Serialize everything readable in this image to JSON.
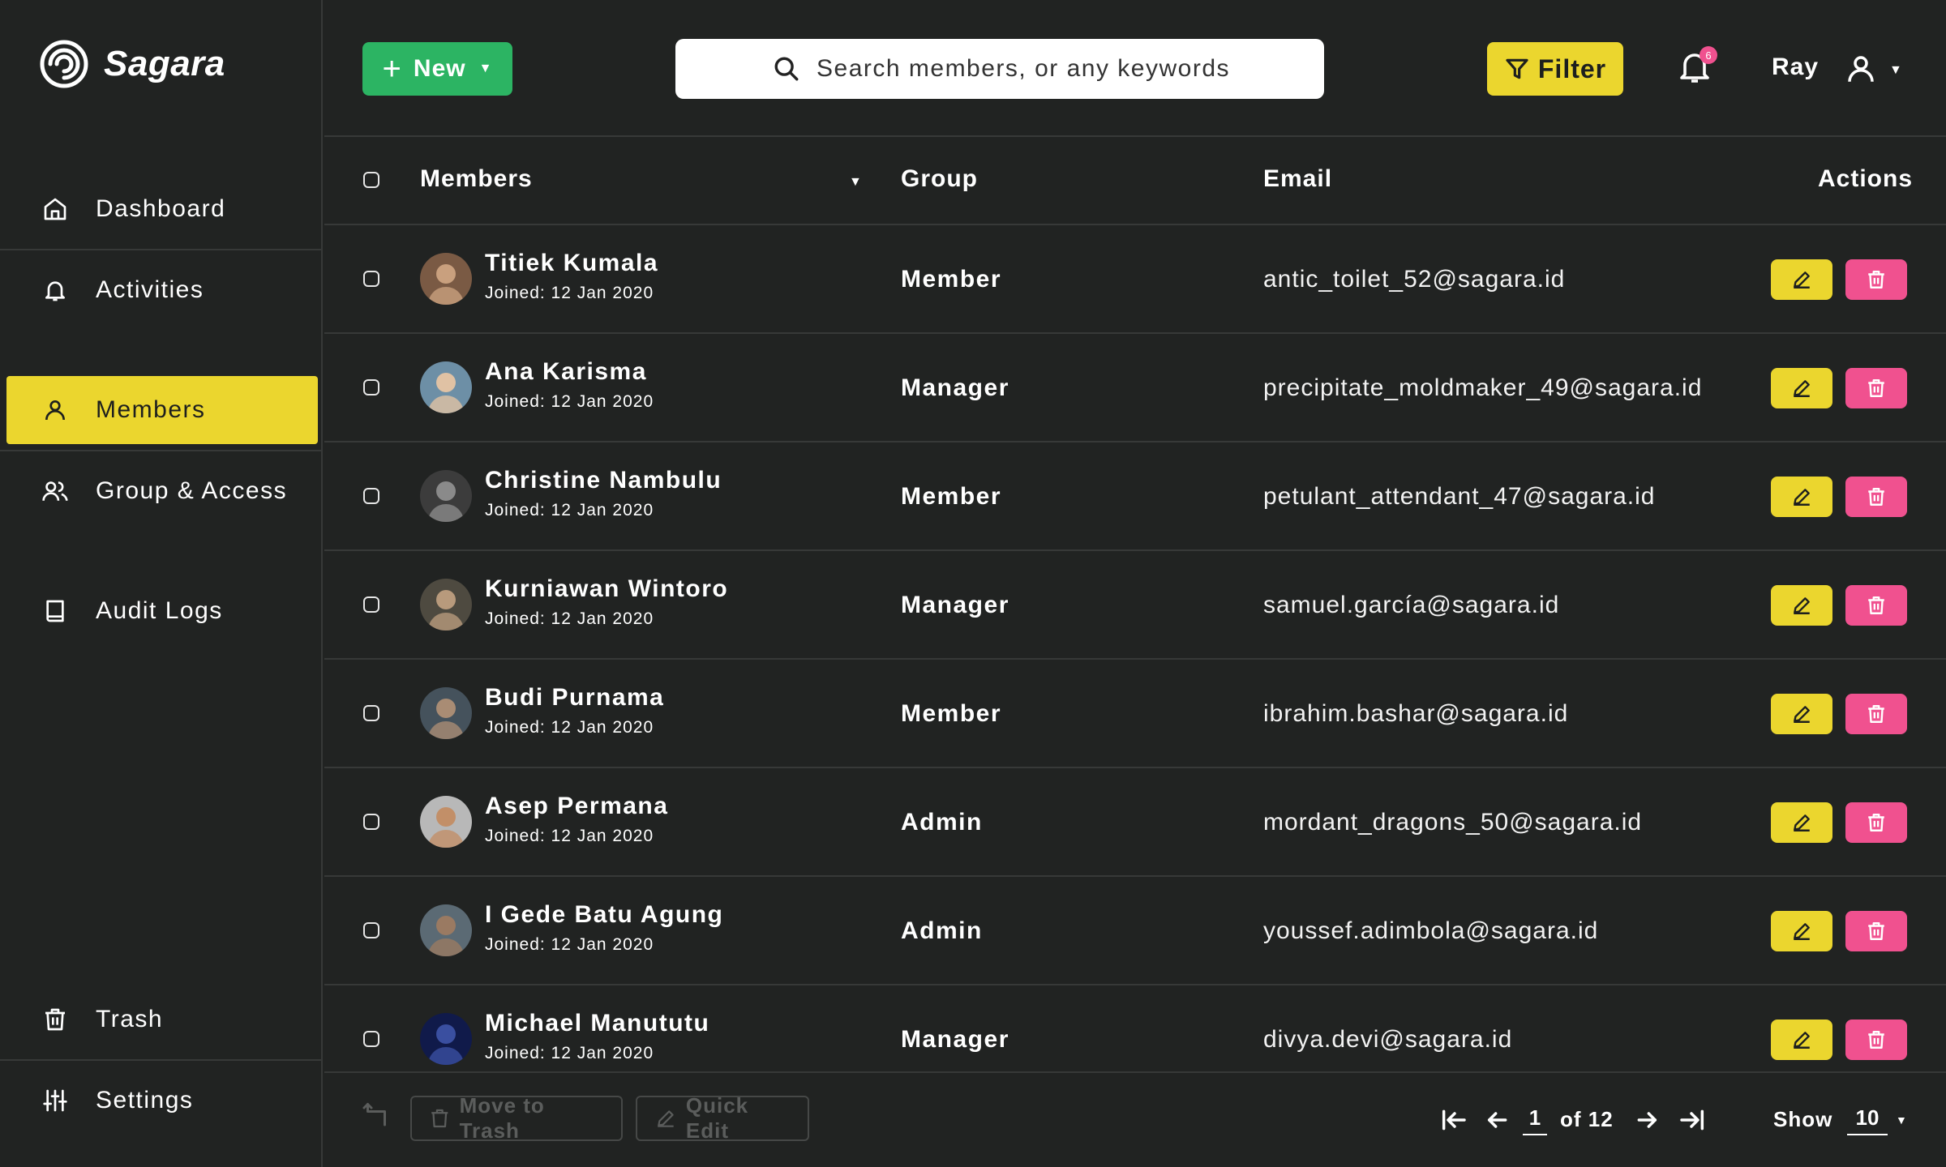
{
  "app": {
    "name": "Sagara"
  },
  "sidebar": {
    "items": [
      {
        "label": "Dashboard",
        "icon": "home-icon"
      },
      {
        "label": "Activities",
        "icon": "bell-icon"
      },
      {
        "label": "Members",
        "icon": "user-icon",
        "active": true
      },
      {
        "label": "Group & Access",
        "icon": "users-icon"
      },
      {
        "label": "Audit Logs",
        "icon": "book-icon"
      },
      {
        "label": "Trash",
        "icon": "trash-icon"
      },
      {
        "label": "Settings",
        "icon": "sliders-icon"
      }
    ]
  },
  "header": {
    "new_label": "New",
    "search_placeholder": "Search members, or any keywords",
    "filter_label": "Filter",
    "notification_count": "6",
    "user_name": "Ray"
  },
  "table": {
    "columns": {
      "members": "Members",
      "group": "Group",
      "email": "Email",
      "actions": "Actions"
    },
    "rows": [
      {
        "name": "Titiek Kumala",
        "joined": "Joined:  12 Jan 2020",
        "group": "Member",
        "email": "antic_toilet_52@sagara.id"
      },
      {
        "name": "Ana Karisma",
        "joined": "Joined:  12 Jan 2020",
        "group": "Manager",
        "email": "precipitate_moldmaker_49@sagara.id"
      },
      {
        "name": "Christine Nambulu",
        "joined": "Joined:  12 Jan 2020",
        "group": "Member",
        "email": "petulant_attendant_47@sagara.id"
      },
      {
        "name": "Kurniawan Wintoro",
        "joined": "Joined:  12 Jan 2020",
        "group": "Manager",
        "email": "samuel.garcía@sagara.id"
      },
      {
        "name": "Budi Purnama",
        "joined": "Joined:  12 Jan 2020",
        "group": "Member",
        "email": "ibrahim.bashar@sagara.id"
      },
      {
        "name": "Asep Permana",
        "joined": "Joined:  12 Jan 2020",
        "group": "Admin",
        "email": "mordant_dragons_50@sagara.id"
      },
      {
        "name": "I Gede Batu Agung",
        "joined": "Joined:  12 Jan 2020",
        "group": "Admin",
        "email": "youssef.adimbola@sagara.id"
      },
      {
        "name": "Michael Manututu",
        "joined": "Joined:  12 Jan 2020",
        "group": "Manager",
        "email": "divya.devi@sagara.id"
      }
    ]
  },
  "footer": {
    "move_to_trash": "Move to Trash",
    "quick_edit": "Quick Edit",
    "current_page": "1",
    "page_total": "of 12",
    "show_label": "Show",
    "show_value": "10"
  },
  "colors": {
    "background": "#212322",
    "accent_yellow": "#ebd62e",
    "accent_green": "#2cb463",
    "accent_pink": "#f0518f"
  }
}
